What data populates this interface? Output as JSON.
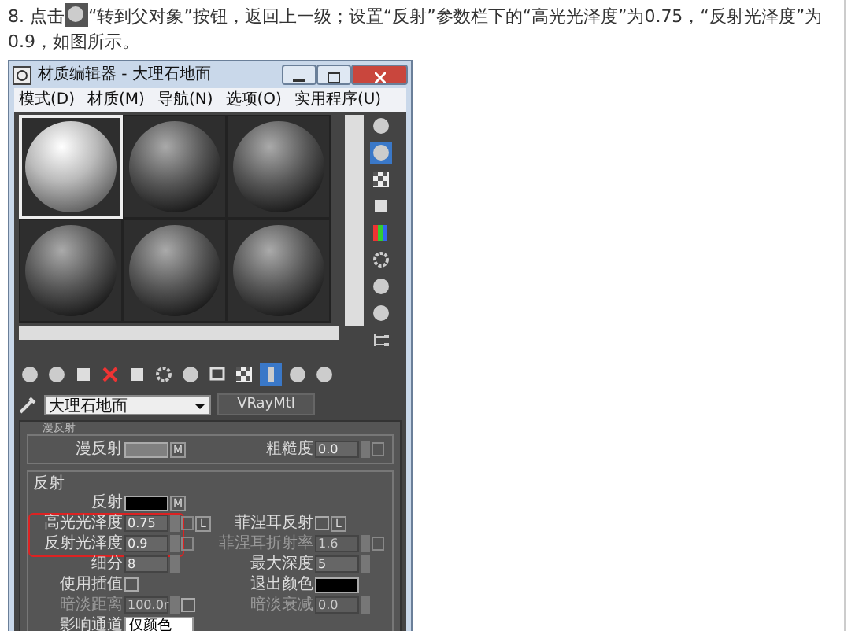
{
  "instruction": {
    "prefix": "8. 点击",
    "text": "“转到父对象”按钮，返回上一级；设置“反射”参数栏下的“高光光泽度”为0.75，“反射光泽度”为0.9，如图所示。"
  },
  "window": {
    "title": "材质编辑器 - 大理石地面"
  },
  "menu": [
    "模式(D)",
    "材质(M)",
    "导航(N)",
    "选项(O)",
    "实用程序(U)"
  ],
  "spheres": [
    {
      "selected": true
    },
    {
      "selected": false
    },
    {
      "selected": false
    },
    {
      "selected": false
    },
    {
      "selected": false
    },
    {
      "selected": false
    }
  ],
  "side_tools": [
    {
      "kind": "sphere",
      "selected": false
    },
    {
      "kind": "sphere",
      "selected": true
    },
    {
      "kind": "checker",
      "selected": false
    },
    {
      "kind": "square",
      "selected": false
    },
    {
      "kind": "bars",
      "selected": false
    },
    {
      "kind": "gear",
      "selected": false
    },
    {
      "kind": "sphere",
      "selected": false
    },
    {
      "kind": "sphere",
      "selected": false
    },
    {
      "kind": "tree",
      "selected": false
    }
  ],
  "toolbar": [
    {
      "kind": "sphere",
      "selected": false
    },
    {
      "kind": "sphere",
      "selected": false
    },
    {
      "kind": "square",
      "selected": false
    },
    {
      "kind": "cross",
      "selected": false
    },
    {
      "kind": "square",
      "selected": false
    },
    {
      "kind": "gear",
      "selected": false
    },
    {
      "kind": "sphere",
      "selected": false
    },
    {
      "kind": "frame",
      "selected": false
    },
    {
      "kind": "checker",
      "selected": false
    },
    {
      "kind": "bar",
      "selected": true
    },
    {
      "kind": "sphere",
      "selected": false
    },
    {
      "kind": "sphere",
      "selected": false
    }
  ],
  "material": {
    "name": "大理石地面",
    "type": "VRayMtl"
  },
  "diffuse": {
    "title": "漫反射",
    "cells": [
      {
        "label": "漫反射",
        "kind": "color",
        "color": "#808080",
        "extras": [
          {
            "kind": "button",
            "label": "M"
          }
        ]
      },
      {
        "label": "粗糙度",
        "kind": "spinner",
        "value": "0.0",
        "disabled": false,
        "extras": [
          {
            "kind": "slot"
          }
        ]
      }
    ]
  },
  "reflection": {
    "title": "反射",
    "rows": [
      {
        "highlighted": false,
        "cells": [
          {
            "label": "反射",
            "kind": "color",
            "color": "#000000",
            "extras": [
              {
                "kind": "button",
                "label": "M"
              }
            ]
          }
        ]
      },
      {
        "highlighted": true,
        "cells": [
          {
            "label": "高光光泽度",
            "kind": "spinner",
            "value": "0.75",
            "disabled": false,
            "extras": [
              {
                "kind": "slot"
              },
              {
                "kind": "button",
                "label": "L"
              }
            ]
          },
          {
            "label": "菲涅耳反射",
            "kind": "checkbox",
            "checked": false,
            "extras": [
              {
                "kind": "button",
                "label": "L"
              }
            ]
          }
        ]
      },
      {
        "highlighted": true,
        "cells": [
          {
            "label": "反射光泽度",
            "kind": "spinner",
            "value": "0.9",
            "disabled": false,
            "extras": [
              {
                "kind": "slot"
              }
            ]
          },
          {
            "label": "菲涅耳折射率",
            "kind": "spinner",
            "value": "1.6",
            "disabled": true,
            "extras": [
              {
                "kind": "slot"
              }
            ]
          }
        ]
      },
      {
        "highlighted": false,
        "cells": [
          {
            "label": "细分",
            "kind": "spinner",
            "value": "8",
            "disabled": false
          },
          {
            "label": "最大深度",
            "kind": "spinner",
            "value": "5",
            "disabled": false
          }
        ]
      },
      {
        "highlighted": false,
        "cells": [
          {
            "label": "使用插值",
            "kind": "checkbox",
            "checked": false
          },
          {
            "label": "退出颜色",
            "kind": "color",
            "color": "#000000"
          }
        ]
      },
      {
        "highlighted": false,
        "cells": [
          {
            "label": "暗淡距离",
            "kind": "spinner",
            "value": "100.0r",
            "disabled": true,
            "extras": [
              {
                "kind": "checkbox",
                "checked": false
              }
            ]
          },
          {
            "label": "暗淡衰减",
            "kind": "spinner",
            "value": "0.0",
            "disabled": true
          }
        ]
      },
      {
        "highlighted": false,
        "cells": [
          {
            "label": "影响通道",
            "kind": "dropdown",
            "value": "仅颜色"
          }
        ]
      }
    ]
  }
}
